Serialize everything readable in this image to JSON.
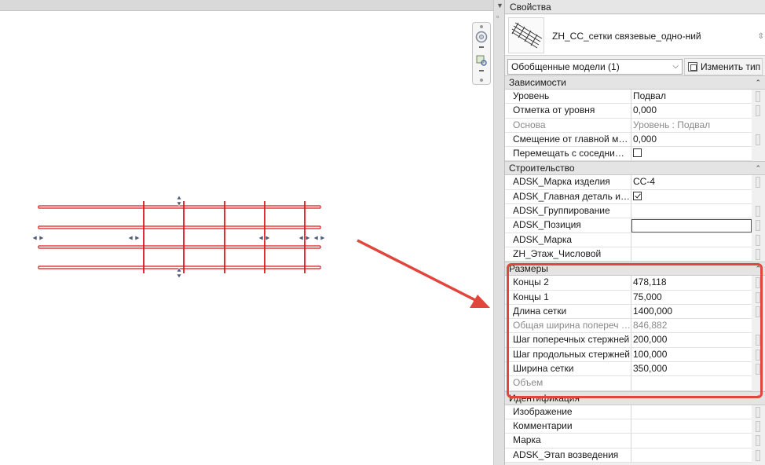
{
  "panel": {
    "title": "Свойства",
    "type_name": "ZH_CC_сетки связевые_одно-ний",
    "filter_value": "Обобщенные модели (1)",
    "edit_type_label": "Изменить тип"
  },
  "groups": [
    {
      "name": "Зависимости",
      "rows": [
        {
          "label": "Уровень",
          "value": "Подвал"
        },
        {
          "label": "Отметка от уровня",
          "value": "0,000"
        },
        {
          "label": "Основа",
          "value": "Уровень : Подвал",
          "disabled": true
        },
        {
          "label": "Смещение от главной мод...",
          "value": "0,000"
        },
        {
          "label": "Перемещать с соседними ...",
          "value": "",
          "checkbox": "off"
        }
      ]
    },
    {
      "name": "Строительство",
      "rows": [
        {
          "label": "ADSK_Марка изделия",
          "value": "СС-4"
        },
        {
          "label": "ADSK_Главная деталь изде...",
          "value": "",
          "checkbox": "on"
        },
        {
          "label": "ADSK_Группирование",
          "value": ""
        },
        {
          "label": "ADSK_Позиция",
          "value": "",
          "boxed": true
        },
        {
          "label": "ADSK_Марка",
          "value": ""
        },
        {
          "label": "ZH_Этаж_Числовой",
          "value": ""
        }
      ]
    },
    {
      "name": "Размеры",
      "rows": [
        {
          "label": "Концы 2",
          "value": "478,118"
        },
        {
          "label": "Концы 1",
          "value": "75,000"
        },
        {
          "label": "Длина сетки",
          "value": "1400,000"
        },
        {
          "label": "Общая ширина попереч с...",
          "value": "846,882",
          "disabled": true
        },
        {
          "label": "Шаг поперечных стержней",
          "value": "200,000"
        },
        {
          "label": "Шаг продольных стержней",
          "value": "100,000"
        },
        {
          "label": "Ширина сетки",
          "value": "350,000"
        },
        {
          "label": "Объем",
          "value": "",
          "disabled": true
        }
      ]
    },
    {
      "name": "Идентификация",
      "rows": [
        {
          "label": "Изображение",
          "value": ""
        },
        {
          "label": "Комментарии",
          "value": ""
        },
        {
          "label": "Марка",
          "value": ""
        },
        {
          "label": "ADSK_Этап возведения",
          "value": ""
        }
      ]
    }
  ],
  "colors": {
    "mesh_line": "#e0161c",
    "annotation_arrow": "#e0463b",
    "grip": "#4d5a7a"
  },
  "icons": {
    "nav_wheel": "steering-wheel-icon",
    "nav_zoom": "zoom-region-icon",
    "collapse": "collapse-arrows-icon"
  }
}
